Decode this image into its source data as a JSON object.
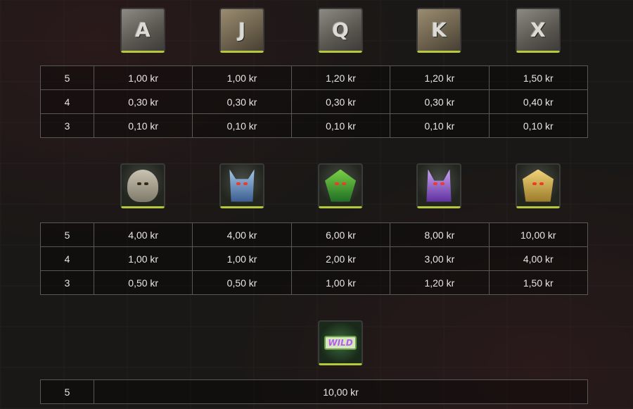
{
  "section1": {
    "symbols": [
      {
        "icon": "a-rune-stone-icon",
        "glyph": "A"
      },
      {
        "icon": "j-rune-stone-icon",
        "glyph": "J"
      },
      {
        "icon": "q-rune-stone-icon",
        "glyph": "Q"
      },
      {
        "icon": "k-rune-stone-icon",
        "glyph": "K"
      },
      {
        "icon": "ten-rune-stone-icon",
        "glyph": "X"
      }
    ],
    "rows": [
      {
        "count": "5",
        "values": [
          "1,00 kr",
          "1,00 kr",
          "1,20 kr",
          "1,20 kr",
          "1,50 kr"
        ]
      },
      {
        "count": "4",
        "values": [
          "0,30 kr",
          "0,30 kr",
          "0,30 kr",
          "0,30 kr",
          "0,40 kr"
        ]
      },
      {
        "count": "3",
        "values": [
          "0,10 kr",
          "0,10 kr",
          "0,10 kr",
          "0,10 kr",
          "0,10 kr"
        ]
      }
    ]
  },
  "section2": {
    "symbols": [
      {
        "icon": "mummy-icon"
      },
      {
        "icon": "blue-anubis-icon"
      },
      {
        "icon": "cobra-icon"
      },
      {
        "icon": "purple-anubis-icon"
      },
      {
        "icon": "golden-pharaoh-icon"
      }
    ],
    "rows": [
      {
        "count": "5",
        "values": [
          "4,00 kr",
          "4,00 kr",
          "6,00 kr",
          "8,00 kr",
          "10,00 kr"
        ]
      },
      {
        "count": "4",
        "values": [
          "1,00 kr",
          "1,00 kr",
          "2,00 kr",
          "3,00 kr",
          "4,00 kr"
        ]
      },
      {
        "count": "3",
        "values": [
          "0,50 kr",
          "0,50 kr",
          "1,00 kr",
          "1,20 kr",
          "1,50 kr"
        ]
      }
    ]
  },
  "section3": {
    "symbol": {
      "icon": "wild-icon",
      "label": "WILD"
    },
    "rows": [
      {
        "count": "5",
        "value": "10,00 kr"
      }
    ]
  }
}
